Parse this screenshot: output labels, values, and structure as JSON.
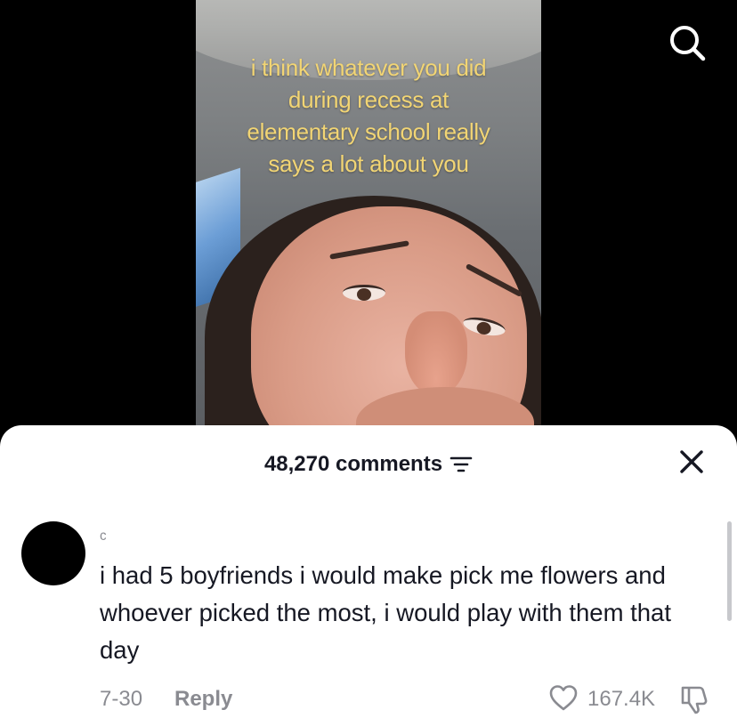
{
  "video": {
    "caption": "i think whatever you did\nduring recess at\nelementary school really\nsays a lot about you"
  },
  "top_bar": {
    "search_icon": "search-icon"
  },
  "comments_sheet": {
    "count_label": "48,270 comments",
    "filter_icon": "filter-icon",
    "close_icon": "close-icon",
    "comment": {
      "username": "ᶜ",
      "text": "i had 5 boyfriends i would make pick me flowers and whoever picked the most, i would play with them that day",
      "date": "7-30",
      "reply_label": "Reply",
      "like_count": "167.4K",
      "like_icon": "heart-outline-icon",
      "dislike_icon": "thumbs-down-icon"
    }
  },
  "colors": {
    "caption": "#f2d574",
    "text_primary": "#161823",
    "text_secondary": "#8a8b91",
    "sheet_bg": "#ffffff",
    "page_bg": "#000000"
  }
}
